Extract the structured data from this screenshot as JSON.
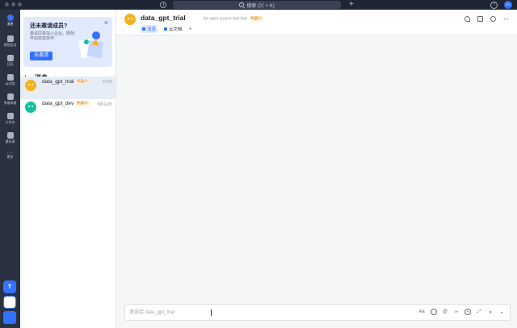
{
  "topbar": {
    "search_placeholder": "搜索 (⌘ + K)",
    "avatar_initials": "ST"
  },
  "leftnav": {
    "items": [
      {
        "label": "消息",
        "icon": "chat-bubble-icon"
      },
      {
        "label": "视频会议",
        "icon": "video-icon"
      },
      {
        "label": "日历",
        "icon": "calendar-icon"
      },
      {
        "label": "云文档",
        "icon": "document-icon"
      },
      {
        "label": "多维表格",
        "icon": "table-icon"
      },
      {
        "label": "工作台",
        "icon": "apps-grid-icon"
      },
      {
        "label": "通讯录",
        "icon": "contacts-icon"
      },
      {
        "label": "更多",
        "icon": "more-icon"
      }
    ]
  },
  "invite": {
    "title": "还未邀请成员?",
    "desc": "邀请同事加入企业，即刻开启高效协作",
    "button": "去邀请"
  },
  "list": {
    "section_title": "消息",
    "chats": [
      {
        "name": "data_gpt_trial",
        "tag": "机器人",
        "time": "17:02",
        "color": "#f6b21a"
      },
      {
        "name": "data_gpt_dev",
        "tag": "机器人",
        "time": "8月14日",
        "color": "#14c0a0"
      }
    ]
  },
  "chat": {
    "title": "data_gpt_trial",
    "desc": "for open source trial test",
    "tag": "机器人",
    "tabs": [
      {
        "label": "消息"
      },
      {
        "label": "云文档"
      }
    ],
    "composer_placeholder": "发送给 data_gpt_trial",
    "tools_font_label": "Aa"
  },
  "colors": {
    "accent": "#3370ff",
    "nav_bg": "#2a3140",
    "bot_tag_bg": "#fff0d6"
  }
}
